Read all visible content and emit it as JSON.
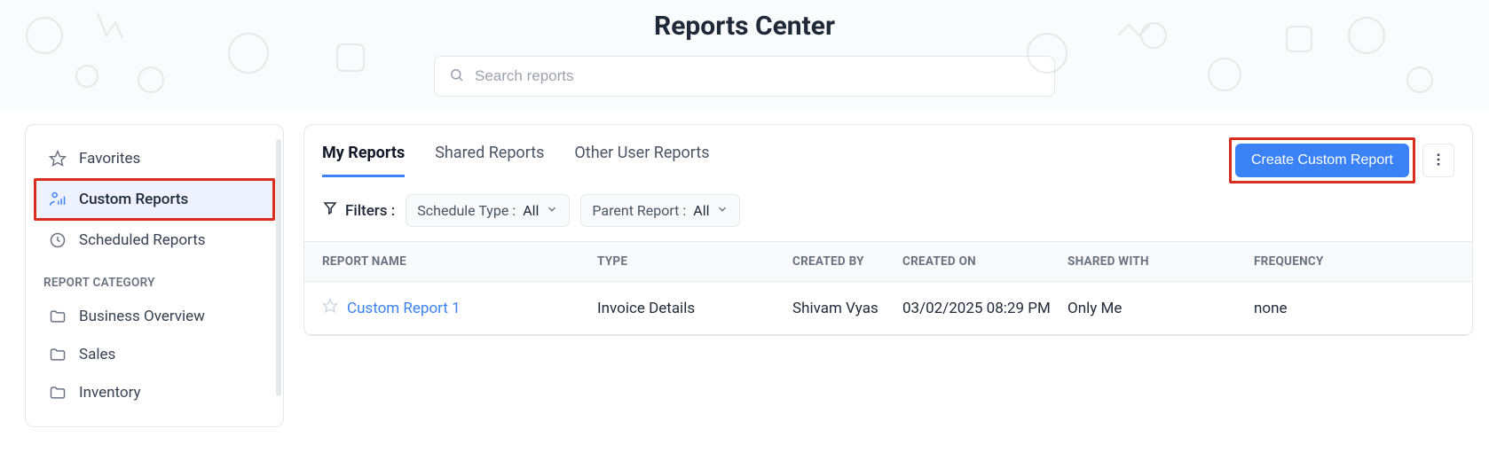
{
  "header": {
    "title": "Reports Center",
    "search_placeholder": "Search reports"
  },
  "sidebar": {
    "items": [
      {
        "label": "Favorites"
      },
      {
        "label": "Custom Reports"
      },
      {
        "label": "Scheduled Reports"
      }
    ],
    "section_label": "REPORT CATEGORY",
    "categories": [
      {
        "label": "Business Overview"
      },
      {
        "label": "Sales"
      },
      {
        "label": "Inventory"
      }
    ]
  },
  "main": {
    "tabs": [
      {
        "label": "My Reports"
      },
      {
        "label": "Shared Reports"
      },
      {
        "label": "Other User Reports"
      }
    ],
    "create_button": "Create Custom Report",
    "filters": {
      "label": "Filters :",
      "schedule_label": "Schedule Type :",
      "schedule_value": "All",
      "parent_label": "Parent Report :",
      "parent_value": "All"
    },
    "columns": {
      "name": "REPORT NAME",
      "type": "TYPE",
      "by": "CREATED BY",
      "on": "CREATED ON",
      "shared": "SHARED WITH",
      "freq": "FREQUENCY"
    },
    "rows": [
      {
        "name": "Custom Report 1",
        "type": "Invoice Details",
        "by": "Shivam Vyas",
        "on": "03/02/2025 08:29 PM",
        "shared": "Only Me",
        "freq": "none"
      }
    ]
  }
}
